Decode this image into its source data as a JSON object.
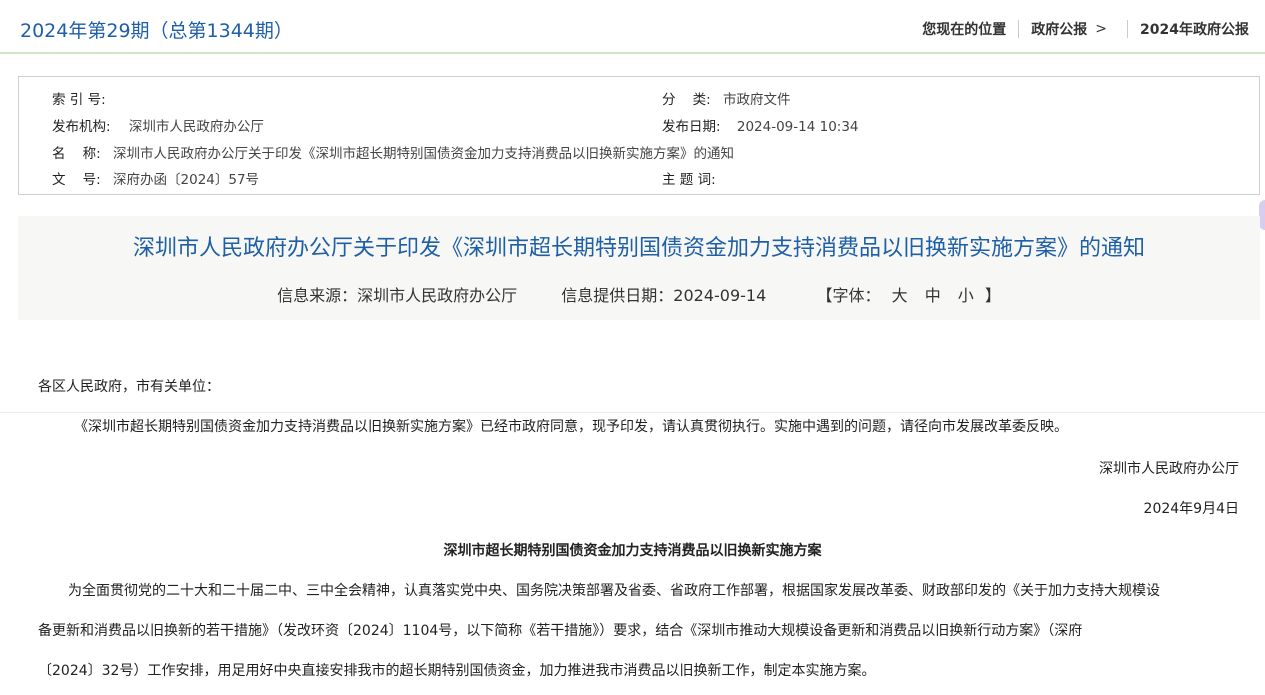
{
  "header": {
    "issue": "2024年第29期（总第1344期）",
    "breadcrumb_label": "您现在的位置",
    "breadcrumb_1": "政府公报",
    "breadcrumb_arrow": ">",
    "breadcrumb_2": "2024年政府公报"
  },
  "meta": {
    "index_label": "索 引 号:",
    "index_value": "",
    "category_label": "分    类:",
    "category_value": "市政府文件",
    "publisher_label": "发布机构:",
    "publisher_value": "深圳市人民政府办公厅",
    "date_label": "发布日期:",
    "date_value": "2024-09-14 10:34",
    "name_label": "名    称:",
    "name_value": "深圳市人民政府办公厅关于印发《深圳市超长期特别国债资金加力支持消费品以旧换新实施方案》的通知",
    "docno_label": "文    号:",
    "docno_value": "深府办函〔2024〕57号",
    "keywords_label": "主 题 词:",
    "keywords_value": ""
  },
  "article": {
    "title": "深圳市人民政府办公厅关于印发《深圳市超长期特别国债资金加力支持消费品以旧换新实施方案》的通知",
    "source": "信息来源：深圳市人民政府办公厅",
    "provide_date": "信息提供日期：2024-09-14",
    "font_label": "【字体：",
    "font_large": "大",
    "font_medium": "中",
    "font_small": "小",
    "font_close": "】",
    "salutation": "各区人民政府，市有关单位：",
    "para1": "《深圳市超长期特别国债资金加力支持消费品以旧换新实施方案》已经市政府同意，现予印发，请认真贯彻执行。实施中遇到的问题，请径向市发展改革委反映。",
    "signature": "深圳市人民政府办公厅",
    "sign_date": "2024年9月4日",
    "plan_title": "深圳市超长期特别国债资金加力支持消费品以旧换新实施方案",
    "plan_line1": "为全面贯彻党的二十大和二十届二中、三中全会精神，认真落实党中央、国务院决策部署及省委、省政府工作部署，根据国家发展改革委、财政部印发的《关于加力支持大规模设",
    "plan_line2": "备更新和消费品以旧换新的若干措施》（发改环资〔2024〕1104号，以下简称《若干措施》）要求，结合《深圳市推动大规模设备更新和消费品以旧换新行动方案》（深府",
    "plan_line3": "〔2024〕32号）工作安排，用足用好中央直接安排我市的超长期特别国债资金，加力推进我市消费品以旧换新工作，制定本实施方案。"
  }
}
